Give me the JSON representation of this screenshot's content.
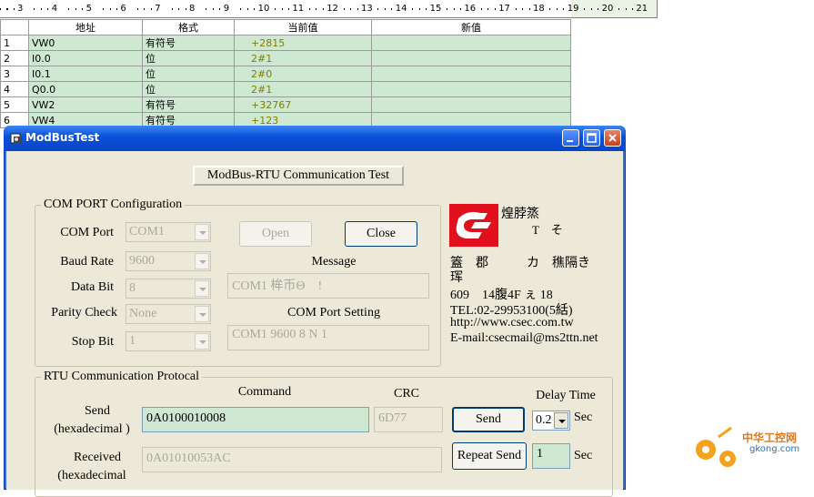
{
  "ruler": {
    "ticks": [
      "3",
      "4",
      "5",
      "6",
      "7",
      "8",
      "9",
      "10",
      "11",
      "12",
      "13",
      "14",
      "15",
      "16",
      "17",
      "18",
      "19",
      "20",
      "21"
    ]
  },
  "table": {
    "headers": [
      "地址",
      "格式",
      "当前值",
      "新值"
    ],
    "rows": [
      {
        "n": "1",
        "addr": "VW0",
        "fmt": "有符号",
        "cur": "+2815",
        "new": ""
      },
      {
        "n": "2",
        "addr": "I0.0",
        "fmt": "位",
        "cur": "2#1",
        "new": ""
      },
      {
        "n": "3",
        "addr": "I0.1",
        "fmt": "位",
        "cur": "2#0",
        "new": ""
      },
      {
        "n": "4",
        "addr": "Q0.0",
        "fmt": "位",
        "cur": "2#1",
        "new": ""
      },
      {
        "n": "5",
        "addr": "VW2",
        "fmt": "有符号",
        "cur": "+32767",
        "new": ""
      },
      {
        "n": "6",
        "addr": "VW4",
        "fmt": "有符号",
        "cur": "+123",
        "new": ""
      }
    ]
  },
  "dialog": {
    "title": "ModBusTest",
    "header_button": "ModBus-RTU Communication Test",
    "com": {
      "group_title": "COM PORT Configuration",
      "port_label": "COM Port",
      "port_value": "COM1",
      "baud_label": "Baud Rate",
      "baud_value": "9600",
      "databit_label": "Data Bit",
      "databit_value": "8",
      "parity_label": "Parity Check",
      "parity_value": "None",
      "stopbit_label": "Stop Bit",
      "stopbit_value": "1",
      "open_label": "Open",
      "close_label": "Close",
      "message_label": "Message",
      "message_value": "COM1 桙币Θ　!",
      "setting_label": "COM Port Setting",
      "setting_value": "COM1 9600 8 N 1"
    },
    "company": {
      "name": "煌脖篜",
      "name2": "T　そ",
      "line1": "篕　郡　　　カ　穛隔き",
      "line1b": "珲",
      "line2": "609　14腹4F ぇ 18",
      "tel": "TEL:02-29953100(5絬)",
      "url": "http://www.csec.com.tw",
      "email": "E-mail:csecmail@ms2ttn.net",
      "logo_color": "#e2101c"
    },
    "rtu": {
      "group_title": "RTU Communication Protocal",
      "command_label": "Command",
      "crc_label": "CRC",
      "send_label": "Send",
      "send_sub": "(hexadecimal )",
      "send_value": "0A0100010008",
      "crc_value": "6D77",
      "send_button": "Send",
      "delay_label": "Delay Time",
      "delay_value": "0.2",
      "sec1": "Sec",
      "received_label": "Received",
      "received_sub": "(hexadecimal",
      "received_value": "0A01010053AC",
      "repeat_button": "Repeat Send",
      "repeat_value": "1",
      "sec2": "Sec"
    }
  },
  "watermark": {
    "text": "中华工控网",
    "sub": "gkong.com"
  }
}
